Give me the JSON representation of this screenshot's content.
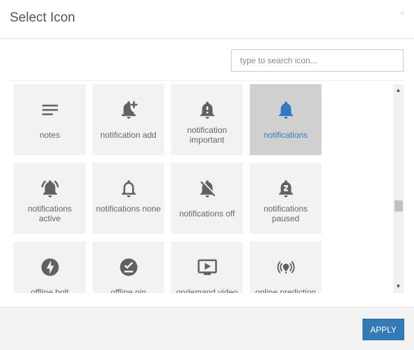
{
  "dialog": {
    "title": "Select Icon",
    "close_label": "×"
  },
  "search": {
    "placeholder": "type to search icon...",
    "value": ""
  },
  "icons": [
    {
      "name": "notes",
      "label": "notes",
      "icon": "notes-icon",
      "selected": false
    },
    {
      "name": "notification_add",
      "label": "notification add",
      "icon": "notification-add-icon",
      "selected": false
    },
    {
      "name": "notification_important",
      "label": "notification important",
      "icon": "notification-important-icon",
      "selected": false
    },
    {
      "name": "notifications",
      "label": "notifications",
      "icon": "notifications-icon",
      "selected": true
    },
    {
      "name": "notifications_active",
      "label": "notifications active",
      "icon": "notifications-active-icon",
      "selected": false
    },
    {
      "name": "notifications_none",
      "label": "notifications none",
      "icon": "notifications-none-icon",
      "selected": false
    },
    {
      "name": "notifications_off",
      "label": "notifications off",
      "icon": "notifications-off-icon",
      "selected": false
    },
    {
      "name": "notifications_paused",
      "label": "notifications paused",
      "icon": "notifications-paused-icon",
      "selected": false
    },
    {
      "name": "offline_bolt",
      "label": "offline bolt",
      "icon": "offline-bolt-icon",
      "selected": false
    },
    {
      "name": "offline_pin",
      "label": "offline pin",
      "icon": "offline-pin-icon",
      "selected": false
    },
    {
      "name": "ondemand_video",
      "label": "ondemand video",
      "icon": "ondemand-video-icon",
      "selected": false
    },
    {
      "name": "online_prediction",
      "label": "online prediction",
      "icon": "online-prediction-icon",
      "selected": false
    }
  ],
  "colors": {
    "icon": "#616161",
    "selected_icon": "#2f78c4",
    "accent": "#337ab7"
  },
  "scrollbar": {
    "up": "▲",
    "down": "▼",
    "position_fraction": 0.58
  },
  "footer": {
    "apply_label": "APPLY"
  }
}
